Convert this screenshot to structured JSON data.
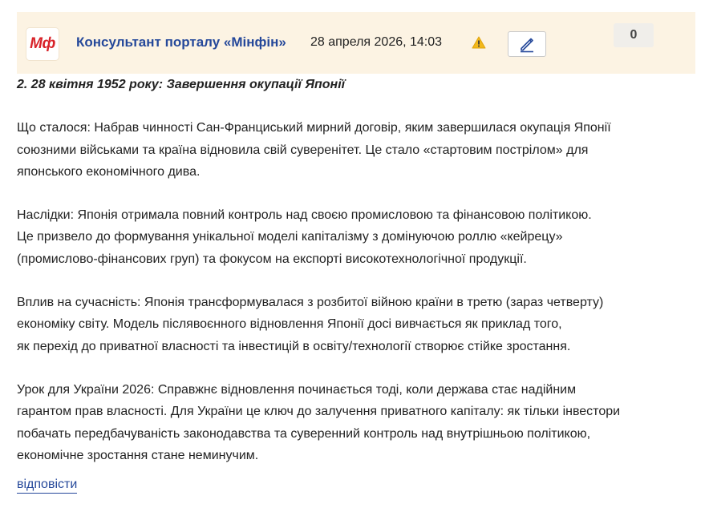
{
  "header": {
    "logo_text": "Мф",
    "author": "Консультант порталу «Мінфін»",
    "date": "28 апреля 2026, 14:03",
    "counter": "0"
  },
  "icons": {
    "warning": "warning-triangle-icon",
    "edit": "pencil-icon"
  },
  "colors": {
    "header_bg": "#fcf3e3",
    "author_link": "#25489a",
    "logo_red": "#d8232a",
    "warning": "#f2b81a"
  },
  "post": {
    "heading": "2. 28 квітня 1952 року: Завершення окупації Японії",
    "paragraphs": [
      [
        "Що сталося: Набрав чинності Сан-Франциський мирний договір, яким завершилася окупація Японії",
        "союзними військами та країна відновила свій суверенітет. Це стало «стартовим пострілом» для",
        "японського економічного дива."
      ],
      [
        "Наслідки: Японія отримала повний контроль над своєю промисловою та фінансовою політикою.",
        "Це призвело до формування унікальної моделі капіталізму з домінуючою роллю «кейрецу»",
        "(промислово-фінансових груп) та фокусом на експорті високотехнологічної продукції."
      ],
      [
        "Вплив на сучасність: Японія трансформувалася з розбитої війною країни в третю (зараз четверту)",
        "економіку світу. Модель післявоєнного відновлення Японії досі вивчається як приклад того,",
        "як перехід до приватної власності та інвестицій в освіту/технології створює стійке зростання."
      ],
      [
        "Урок для України 2026: Справжнє відновлення починається тоді, коли держава стає надійним",
        "гарантом прав власності. Для України це ключ до залучення приватного капіталу: як тільки інвестори",
        "побачать передбачуваність законодавства та суверенний контроль над внутрішньою політикою,",
        "економічне зростання стане неминучим."
      ]
    ],
    "reply_label": "відповісти"
  }
}
